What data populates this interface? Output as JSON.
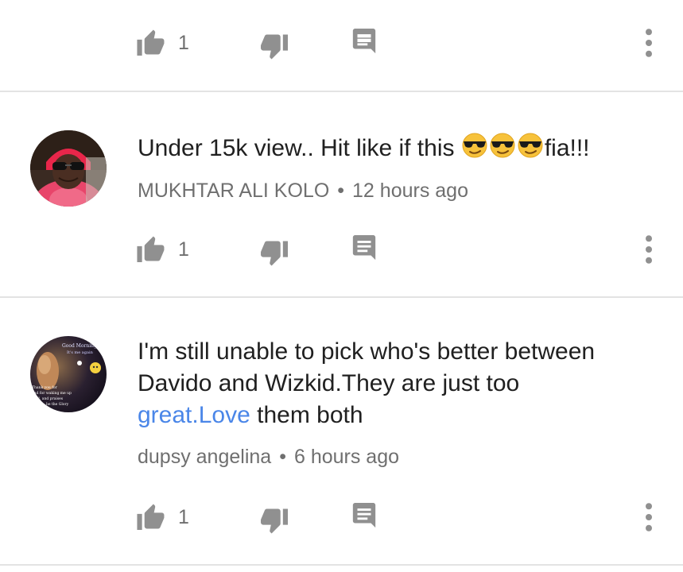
{
  "comments": [
    {
      "text": "",
      "author": "",
      "time": "",
      "likes": "1"
    },
    {
      "text_before": "Under 15k view.. Hit like if this ",
      "emojis": [
        "smiling-face-with-sunglasses",
        "smiling-face-with-sunglasses",
        "smiling-face-with-sunglasses"
      ],
      "text_after": "fia!!!",
      "author": "MUKHTAR ALI KOLO",
      "separator": "•",
      "time": "12 hours ago",
      "likes": "1"
    },
    {
      "text_line1": "I'm still unable to pick who's better between",
      "text_line2": "Davido and Wizkid.They are just too",
      "link_text": "great.Love",
      "text_after_link": " them both",
      "author": "dupsy angelina",
      "separator": "•",
      "time": "6 hours ago",
      "likes": "1",
      "avatar_lettering": [
        "Good Morning",
        "It's me again",
        "Thank you for",
        "and for waking me up",
        "loud, and praises",
        "be the Glory"
      ]
    }
  ],
  "icons": {
    "like": "thumb-up-icon",
    "dislike": "thumb-down-icon",
    "reply": "reply-comment-icon",
    "more": "more-vert-icon"
  },
  "colors": {
    "text": "#202020",
    "meta": "#6f6f6f",
    "icon": "#909090",
    "link": "#4a86e8",
    "divider": "#e3e3e3"
  }
}
